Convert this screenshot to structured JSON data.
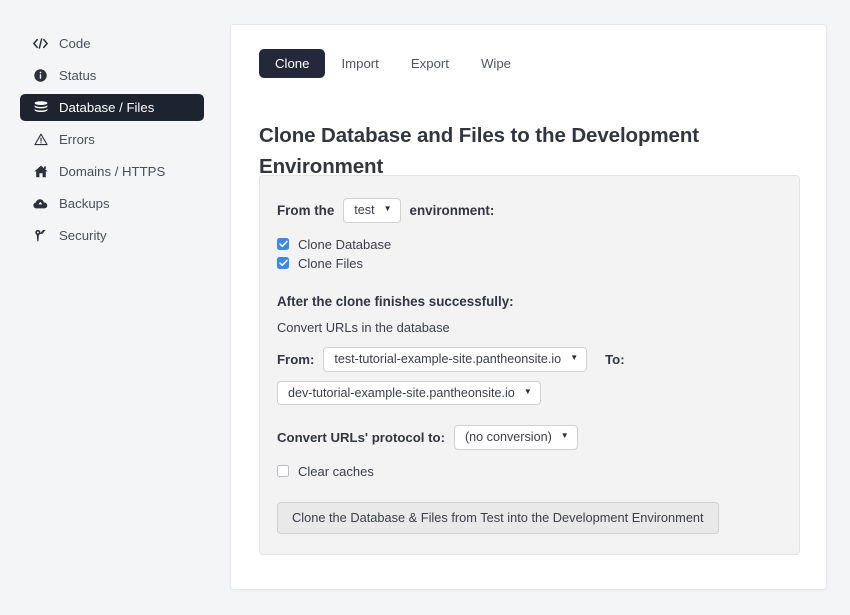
{
  "sidebar": {
    "items": [
      {
        "label": "Code",
        "icon": "code-brackets-icon",
        "active": false
      },
      {
        "label": "Status",
        "icon": "info-circle-icon",
        "active": false
      },
      {
        "label": "Database / Files",
        "icon": "database-icon",
        "active": true
      },
      {
        "label": "Errors",
        "icon": "warning-triangle-icon",
        "active": false
      },
      {
        "label": "Domains / HTTPS",
        "icon": "home-icon",
        "active": false
      },
      {
        "label": "Backups",
        "icon": "cloud-upload-icon",
        "active": false
      },
      {
        "label": "Security",
        "icon": "key-icon",
        "active": false
      }
    ]
  },
  "tabs": [
    {
      "label": "Clone",
      "active": true
    },
    {
      "label": "Import",
      "active": false
    },
    {
      "label": "Export",
      "active": false
    },
    {
      "label": "Wipe",
      "active": false
    }
  ],
  "heading": "Clone Database and Files to the Development Environment",
  "form": {
    "from_the_label": "From the",
    "environment_label": "environment:",
    "environment_select": {
      "value": "test"
    },
    "checkboxes": [
      {
        "label": "Clone Database",
        "checked": true
      },
      {
        "label": "Clone Files",
        "checked": true
      }
    ],
    "after_clone_title": "After the clone finishes successfully:",
    "convert_urls_text": "Convert URLs in the database",
    "from_label": "From:",
    "from_select": {
      "value": "test-tutorial-example-site.pantheonsite.io"
    },
    "to_label": "To:",
    "to_select": {
      "value": "dev-tutorial-example-site.pantheonsite.io"
    },
    "protocol_label": "Convert URLs' protocol to:",
    "protocol_select": {
      "value": "(no conversion)"
    },
    "clear_caches": {
      "label": "Clear caches",
      "checked": false
    },
    "submit_label": "Clone the Database & Files from Test into the Development Environment"
  },
  "colors": {
    "page_background": "#f4f5f7",
    "card_background": "#ffffff",
    "panel_background": "#f3f3f4",
    "active_dark": "#1e2330",
    "checkbox_blue": "#3b89e8",
    "text_primary": "#32363e"
  }
}
